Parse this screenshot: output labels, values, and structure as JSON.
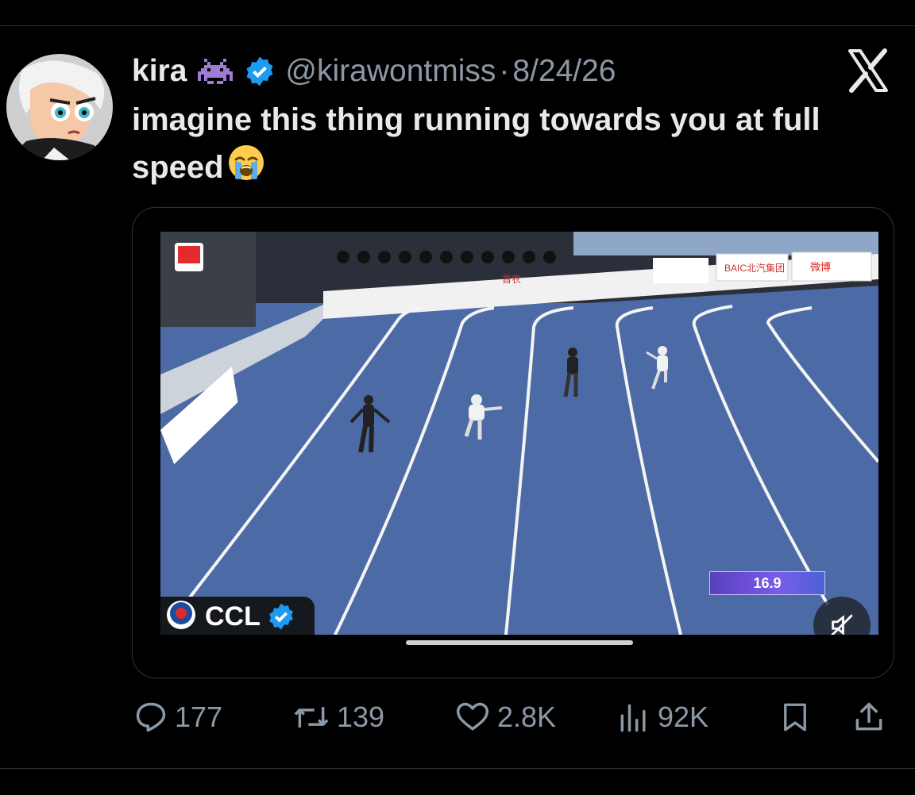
{
  "tweet": {
    "display_name": "kira",
    "name_emoji": "space-invader-icon",
    "handle": "@kirawontmiss",
    "separator": "·",
    "date": "8/24/26",
    "text": "imagine this thing running towards you at full speed",
    "text_emoji": "loudly-crying-face-icon"
  },
  "media": {
    "source_name": "CCL",
    "timer": "16.9",
    "ad_boards": [
      "BAIC北汽集团",
      "微博",
      "首农"
    ]
  },
  "actions": {
    "reply_count": "177",
    "retweet_count": "139",
    "like_count": "2.8K",
    "views_count": "92K"
  },
  "colors": {
    "background": "#000000",
    "text": "#e7e9ea",
    "muted": "#8b98a5",
    "verified": "#1d9bf0",
    "track": "#4c6aa6"
  }
}
